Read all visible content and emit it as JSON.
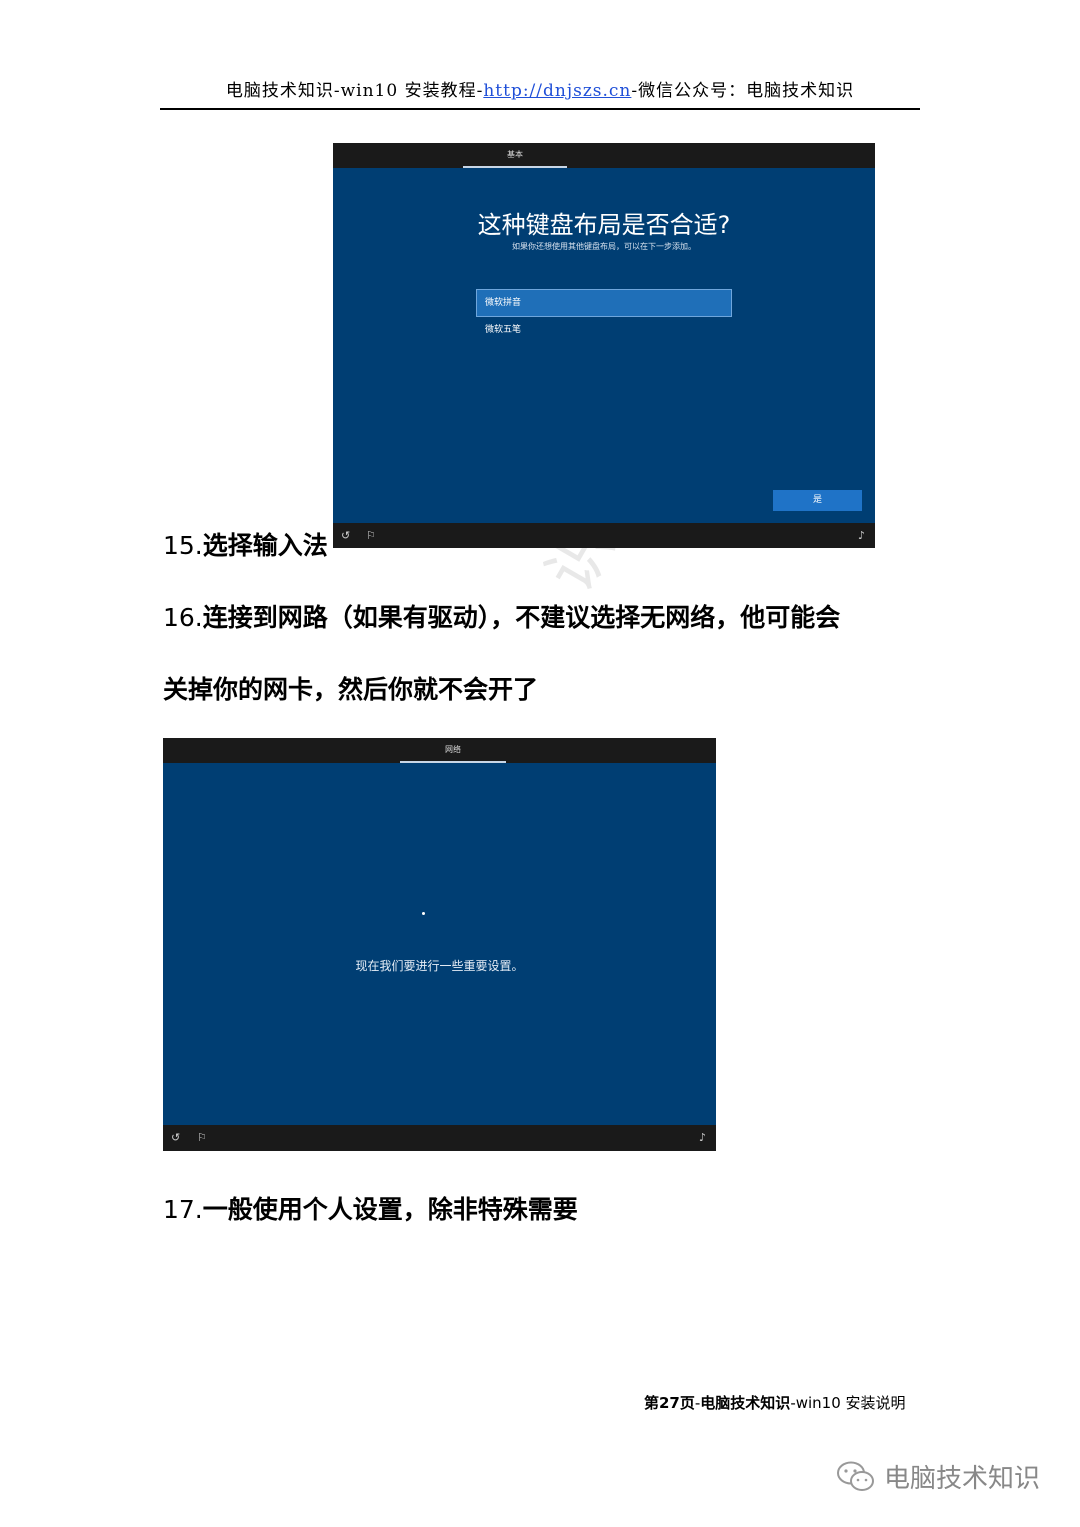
{
  "header": {
    "prefix": "电脑技术知识-win10 安装教程-",
    "url": "http://dnjszs.cn",
    "suffix": "-微信公众号：电脑技术知识"
  },
  "screenshot1": {
    "tab": "基本",
    "title": "这种键盘布局是否合适?",
    "subtitle": "如果你还想使用其他键盘布局，可以在下一步添加。",
    "options": [
      "微软拼音",
      "微软五笔"
    ],
    "yes_button": "是"
  },
  "screenshot2": {
    "tab": "网络",
    "message": "现在我们要进行一些重要设置。"
  },
  "steps": [
    {
      "num": "15.",
      "text": "选择输入法"
    },
    {
      "num": "16.",
      "text": "连接到网路（如果有驱动），不建议选择无网络，他可能会"
    },
    {
      "num": "",
      "text": "关掉你的网卡，然后你就不会开了"
    },
    {
      "num": "17.",
      "text": "一般使用个人设置，除非特殊需要"
    }
  ],
  "watermark": "识 dnjszs",
  "footer": {
    "page": "第27页",
    "sep1": "-",
    "site": "电脑技术知识",
    "sep2": "-",
    "title": "win10 安装说明"
  },
  "wechat_account": "电脑技术知识"
}
